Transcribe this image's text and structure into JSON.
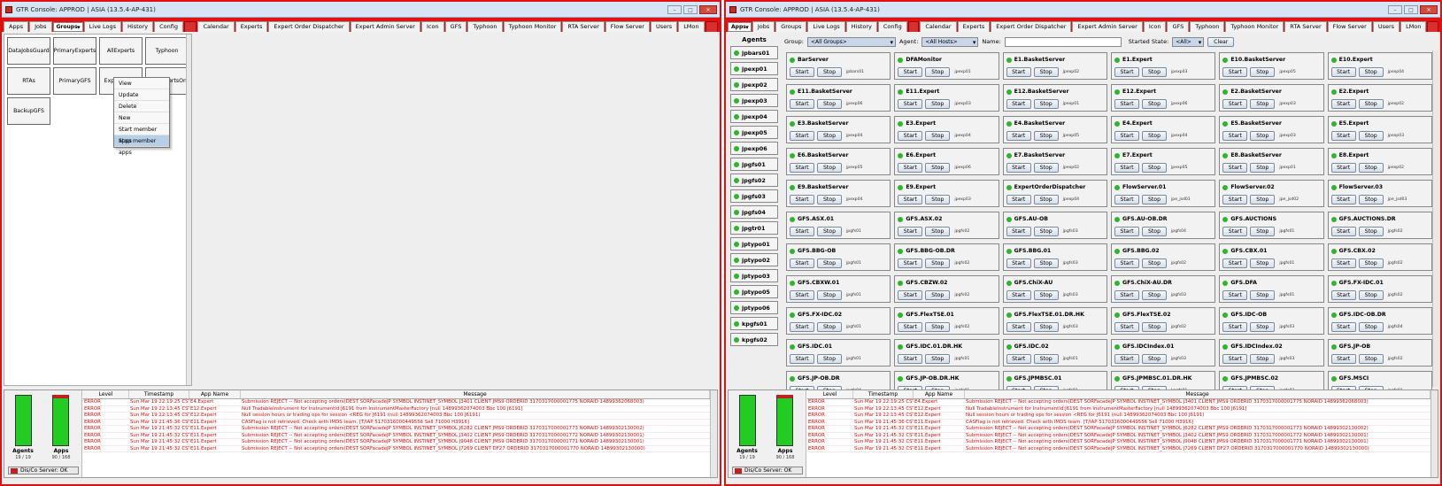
{
  "left": {
    "title": "GTR Console: APPROD | ASIA (13.5.4-AP-431)",
    "tabs": [
      "Apps",
      "Jobs",
      "Groups",
      "Live Logs",
      "History",
      "Config",
      "",
      "Calendar",
      "Experts",
      "Expert Order Dispatcher",
      "Expert Admin Server",
      "Icon",
      "GFS",
      "Typhoon",
      "Typhoon Monitor",
      "RTA Server",
      "Flow Server",
      "Users",
      "LMon",
      ""
    ],
    "selected_tab": 2,
    "groups": [
      "DataJobsGuard",
      "PrimaryExperts",
      "AllExperts",
      "Typhoon",
      "RTAs",
      "PrimaryGFS",
      "ExpertsOnly",
      "BetaExpertsOnl",
      "BackupGFS"
    ],
    "context_menu": [
      "View",
      "Update",
      "Delete",
      "New",
      "Start member apps",
      "Stop member apps"
    ]
  },
  "right": {
    "title": "GTR Console: APPROD | ASIA (13.5.4-AP-431)",
    "tabs": [
      "Apps",
      "Jobs",
      "Groups",
      "Live Logs",
      "History",
      "Config",
      "",
      "Calendar",
      "Experts",
      "Expert Order Dispatcher",
      "Expert Admin Server",
      "Icon",
      "GFS",
      "Typhoon",
      "Typhoon Monitor",
      "RTA Server",
      "Flow Server",
      "Users",
      "LMon",
      ""
    ],
    "selected_tab": 0,
    "agents_header": "Agents",
    "agents": [
      "jpbars01",
      "jpexp01",
      "jpexp02",
      "jpexp03",
      "jpexp04",
      "jpexp05",
      "jpexp06",
      "jpgfs01",
      "jpgfs02",
      "jpgfs03",
      "jpgfs04",
      "jpgtr01",
      "jptypo01",
      "jptypo02",
      "jptypo03",
      "jptypo05",
      "jptypo06",
      "kpgfs01",
      "kpgfs02"
    ],
    "filter": {
      "group_label": "Group:",
      "group_value": "<All Groups>",
      "agent_label": "Agent:",
      "agent_value": "<All Hosts>",
      "name_label": "Name:",
      "started_label": "Started State:",
      "started_value": "<All>",
      "clear": "Clear"
    },
    "start_label": "Start",
    "stop_label": "Stop",
    "apps": [
      [
        "BarServer",
        "jpbars01"
      ],
      [
        "DFAMonitor",
        "jpexp01"
      ],
      [
        "E1.BasketServer",
        "jpexp02"
      ],
      [
        "E1.Expert",
        "jpexp03"
      ],
      [
        "E10.BasketServer",
        "jpexp05"
      ],
      [
        "E10.Expert",
        "jpexp04"
      ],
      [
        "E11.BasketServer",
        "jpexp06"
      ],
      [
        "E11.Expert",
        "jpexp03"
      ],
      [
        "E12.BasketServer",
        "jpexp01"
      ],
      [
        "E12.Expert",
        "jpexp06"
      ],
      [
        "E2.BasketServer",
        "jpexp03"
      ],
      [
        "E2.Expert",
        "jpexp02"
      ],
      [
        "E3.BasketServer",
        "jpexp04"
      ],
      [
        "E3.Expert",
        "jpexp04"
      ],
      [
        "E4.BasketServer",
        "jpexp05"
      ],
      [
        "E4.Expert",
        "jpexp04"
      ],
      [
        "E5.BasketServer",
        "jpexp03"
      ],
      [
        "E5.Expert",
        "jpexp03"
      ],
      [
        "E6.BasketServer",
        "jpexp05"
      ],
      [
        "E6.Expert",
        "jpexp06"
      ],
      [
        "E7.BasketServer",
        "jpexp02"
      ],
      [
        "E7.Expert",
        "jpexp05"
      ],
      [
        "E8.BasketServer",
        "jpexp01"
      ],
      [
        "E8.Expert",
        "jpexp02"
      ],
      [
        "E9.BasketServer",
        "jpexp04"
      ],
      [
        "E9.Expert",
        "jpexp03"
      ],
      [
        "ExpertOrderDispatcher",
        "jpexp04"
      ],
      [
        "FlowServer.01",
        "jpe_jsd01"
      ],
      [
        "FlowServer.02",
        "jpe_jsd02"
      ],
      [
        "FlowServer.03",
        "jpe_jsd03"
      ],
      [
        "GFS.ASX.01",
        "jpgfs01"
      ],
      [
        "GFS.ASX.02",
        "jpgfs02"
      ],
      [
        "GFS.AU-OB",
        "jpgfs03"
      ],
      [
        "GFS.AU-OB.DR",
        "jpgfs04"
      ],
      [
        "GFS.AUCTIONS",
        "jpgfs01"
      ],
      [
        "GFS.AUCTIONS.DR",
        "jpgfs02"
      ],
      [
        "GFS.BBG-OB",
        "jpgfs01"
      ],
      [
        "GFS.BBG-OB.DR",
        "jpgfs02"
      ],
      [
        "GFS.BBG.01",
        "jpgfs03"
      ],
      [
        "GFS.BBG.02",
        "jpgfs02"
      ],
      [
        "GFS.CBX.01",
        "jpgfs01"
      ],
      [
        "GFS.CBX.02",
        "jpgfs02"
      ],
      [
        "GFS.CBXW.01",
        "jpgfs01"
      ],
      [
        "GFS.CBZW.02",
        "jpgfs02"
      ],
      [
        "GFS.ChiX-AU",
        "jpgfs03"
      ],
      [
        "GFS.ChiX-AU.DR",
        "jpgfs03"
      ],
      [
        "GFS.DFA",
        "jpgfs01"
      ],
      [
        "GFS.FX-IDC.01",
        "jpgfs02"
      ],
      [
        "GFS.FX-IDC.02",
        "jpgfs01"
      ],
      [
        "GFS.FlexTSE.01",
        "jpgfs02"
      ],
      [
        "GFS.FlexTSE.01.DR.HK",
        "jpgfs03"
      ],
      [
        "GFS.FlexTSE.02",
        "jpgfs02"
      ],
      [
        "GFS.IDC-OB",
        "jpgfs03"
      ],
      [
        "GFS.IDC-OB.DR",
        "jpgfs04"
      ],
      [
        "GFS.IDC.01",
        "jpgfs01"
      ],
      [
        "GFS.IDC.01.DR.HK",
        "jpgfs01"
      ],
      [
        "GFS.IDC.02",
        "jpgfs01"
      ],
      [
        "GFS.IDCIndex.01",
        "jpgfs03"
      ],
      [
        "GFS.IDCIndex.02",
        "jpgfs03"
      ],
      [
        "GFS.JP-OB",
        "jpgfs02"
      ],
      [
        "GFS.JP-OB.DR",
        "jpgfs04"
      ],
      [
        "GFS.JP-OB.DR.HK",
        "jpgfs01"
      ],
      [
        "GFS.JPMBSC.01",
        "jpgfs01"
      ],
      [
        "GFS.JPMBSC.01.DR.HK",
        "kpgfs01"
      ],
      [
        "GFS.JPMBSC.02",
        "jpgfs02"
      ],
      [
        "GFS.MSCI",
        "jpgfs01"
      ]
    ]
  },
  "status": {
    "agents_label": "Agents",
    "agents_count": "19 / 19",
    "apps_label": "Apps",
    "apps_count": "90 / 168",
    "server": "Dis/Co Server: OK"
  },
  "log": {
    "headers": [
      "Level",
      "Timestamp",
      "App Name",
      "Message"
    ],
    "rows": [
      [
        "ERROR",
        "Sun Mar 19 22:19:25 CST",
        "E4.Expert",
        "Submission REJECT -- Not accepting orders(DEST SORFacadeJP SYMBOL INSTINET_SYMBOL J3401 CLIENT JMS9 ORDERID 3170317000001775 NORAID 14899362068003)"
      ],
      [
        "ERROR",
        "Sun Mar 19 22:13:45 CST",
        "E12.Expert",
        "Null TradableInstrument for InstrumentId:J6191 from InstrumentMasterFactory [null 14899362074003 Bbc 100 J6191]"
      ],
      [
        "ERROR",
        "Sun Mar 19 22:13:45 CST",
        "E12.Expert",
        "Null session hours or trading ops for session <REG for J6191 (null 14899362074003 Bbc 100 J6191)"
      ],
      [
        "ERROR",
        "Sun Mar 19 21:45:36 CST",
        "E11.Expert",
        "CASFlag is not retrieved. Check with IMDS team. [T/IAP 5170316000449556 Sell 71000 H3916]"
      ],
      [
        "ERROR",
        "Sun Mar 19 21:45:32 CST",
        "E11.Expert",
        "Submission REJECT -- Not accepting orders(DEST SORFacadeJP SYMBOL INSTINET_SYMBOL J6282 CLIENT JMS9 ORDERID 3170317000001773 NORAID 14899302130002)"
      ],
      [
        "ERROR",
        "Sun Mar 19 21:45:32 CST",
        "E11.Expert",
        "Submission REJECT -- Not accepting orders(DEST SORFacadeJP SYMBOL INSTINET_SYMBOL J3402 CLIENT JMS9 ORDERID 3170317000001772 NORAID 14899302130001)"
      ],
      [
        "ERROR",
        "Sun Mar 19 21:45:32 CST",
        "E11.Expert",
        "Submission REJECT -- Not accepting orders(DEST SORFacadeJP SYMBOL INSTINET_SYMBOL J9048 CLIENT JMS9 ORDERID 3170317000001771 NORAID 14899302130001)"
      ],
      [
        "ERROR",
        "Sun Mar 19 21:45:32 CST",
        "E11.Expert",
        "Submission REJECT -- Not accepting orders(DEST SORFacadeJP SYMBOL INSTINET_SYMBOL J7269 CLIENT DF27 ORDERID 3170317000001770 NORAID 14899302130000)"
      ]
    ]
  },
  "colors": {
    "accent_red": "#e01010",
    "running_green": "#2db52d",
    "selection": "#c8d6ea"
  }
}
